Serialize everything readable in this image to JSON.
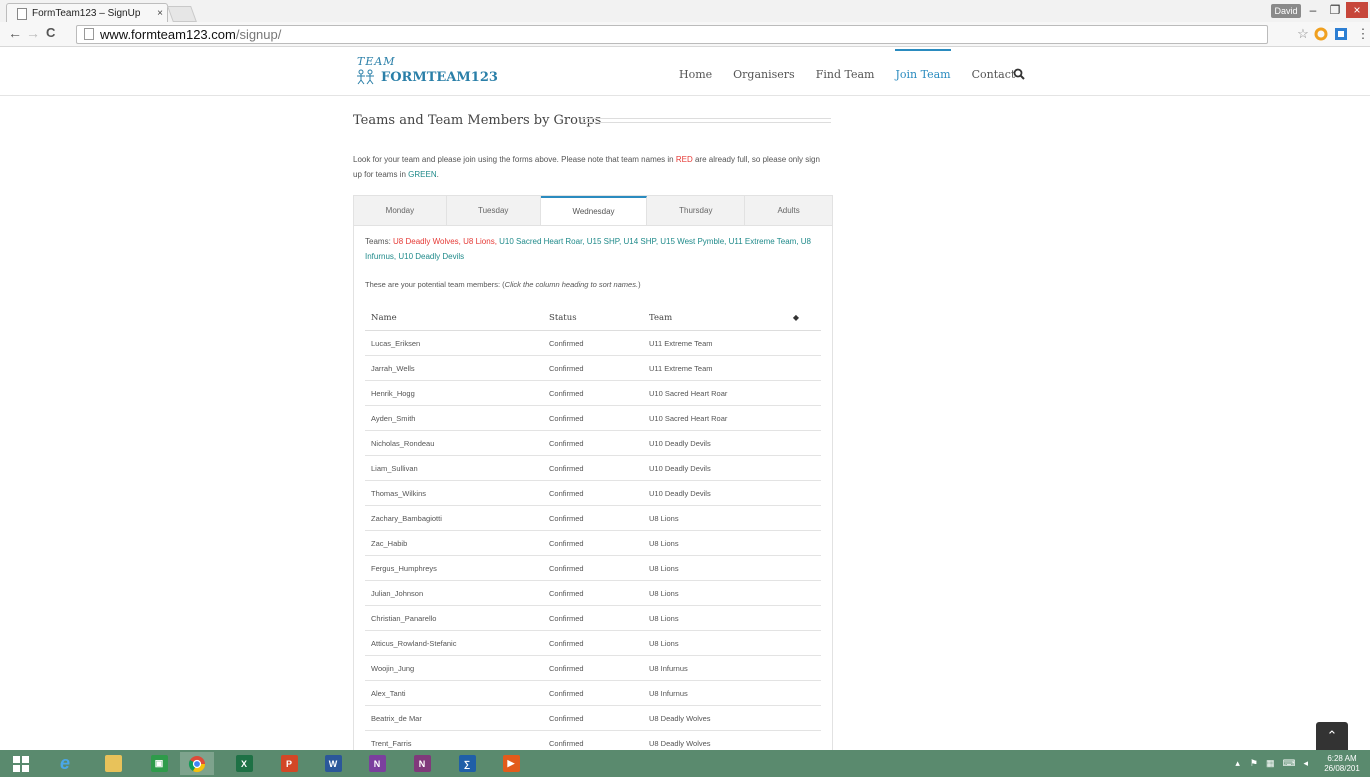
{
  "browser": {
    "tab_title": "FormTeam123 – SignUp",
    "tab_close": "×",
    "url_host": "www.formteam123.com",
    "url_path": "/signup/",
    "user_name": "David",
    "minimize": "–",
    "maximize": "❐",
    "close": "×",
    "back": "←",
    "forward": "→",
    "reload": "C",
    "star": "☆",
    "menu": "⋮"
  },
  "site": {
    "logo_small": "TEAM",
    "logo_brand": "FORMTEAM123",
    "nav": [
      "Home",
      "Organisers",
      "Find Team",
      "Join Team",
      "Contact"
    ],
    "active_nav": "Join Team"
  },
  "section": {
    "title": "Teams and Team Members by Groups",
    "intro_1": "Look for your team and please join using the forms above. Please note that team names in ",
    "intro_red": "RED",
    "intro_2": " are already full, so please only sign up for teams in ",
    "intro_green": "GREEN",
    "intro_3": "."
  },
  "tabs": [
    "Monday",
    "Tuesday",
    "Wednesday",
    "Thursday",
    "Adults"
  ],
  "active_tab": "Wednesday",
  "panel": {
    "teams_prefix": "Teams: ",
    "full_teams": "U8 Deadly Wolves, U8 Lions,",
    "open_teams": " U10 Sacred Heart Roar, U15 SHP, U14 SHP, U15 West Pymble, U11 Extreme Team, U8 Infurnus, U10 Deadly Devils",
    "members_note": "These are your potential team members: (",
    "members_note_em": "Click the column heading to sort names.",
    "members_note_end": ")",
    "columns": [
      "Name",
      "Status",
      "Team"
    ],
    "sort_icon": "◆",
    "rows": [
      [
        "Lucas_Eriksen",
        "Confirmed",
        "U11 Extreme Team"
      ],
      [
        "Jarrah_Wells",
        "Confirmed",
        "U11 Extreme Team"
      ],
      [
        "Henrik_Hogg",
        "Confirmed",
        "U10 Sacred Heart Roar"
      ],
      [
        "Ayden_Smith",
        "Confirmed",
        "U10 Sacred Heart Roar"
      ],
      [
        "Nicholas_Rondeau",
        "Confirmed",
        "U10 Deadly Devils"
      ],
      [
        "Liam_Sullivan",
        "Confirmed",
        "U10 Deadly Devils"
      ],
      [
        "Thomas_Wilkins",
        "Confirmed",
        "U10 Deadly Devils"
      ],
      [
        "Zachary_Bambagiotti",
        "Confirmed",
        "U8 Lions"
      ],
      [
        "Zac_Habib",
        "Confirmed",
        "U8 Lions"
      ],
      [
        "Fergus_Humphreys",
        "Confirmed",
        "U8 Lions"
      ],
      [
        "Julian_Johnson",
        "Confirmed",
        "U8 Lions"
      ],
      [
        "Christian_Panarello",
        "Confirmed",
        "U8 Lions"
      ],
      [
        "Atticus_Rowland-Stefanic",
        "Confirmed",
        "U8 Lions"
      ],
      [
        "Woojin_Jung",
        "Confirmed",
        "U8 Infurnus"
      ],
      [
        "Alex_Tanti",
        "Confirmed",
        "U8 Infurnus"
      ],
      [
        "Beatrix_de Mar",
        "Confirmed",
        "U8 Deadly Wolves"
      ],
      [
        "Trent_Farris",
        "Confirmed",
        "U8 Deadly Wolves"
      ]
    ]
  },
  "back_to_top": "⌃",
  "taskbar": {
    "time": "6:28 AM",
    "date": "26/08/201"
  },
  "colors": {
    "accent": "#2a8bbf",
    "full_team": "#e53935",
    "open_team": "#1f8a8a",
    "taskbar": "#5a8a6e"
  }
}
